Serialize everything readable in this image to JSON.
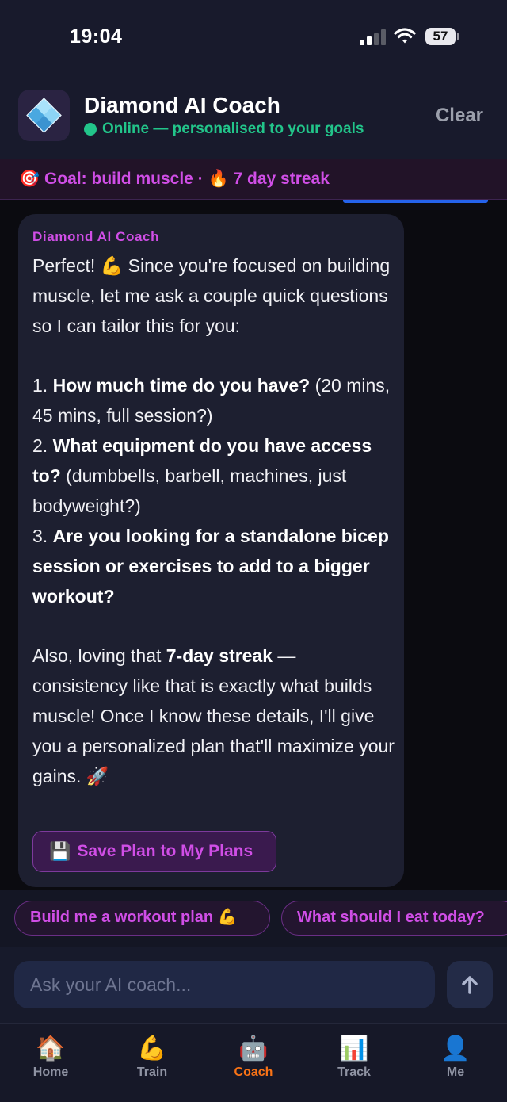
{
  "status_bar": {
    "time": "19:04",
    "battery": "57"
  },
  "header": {
    "title": "Diamond AI Coach",
    "status": "Online — personalised to your goals",
    "clear_label": "Clear"
  },
  "goal_bar": {
    "text": "🎯 Goal: build muscle · 🔥 7 day streak"
  },
  "message": {
    "sender": "Diamond AI Coach",
    "intro": "Perfect! 💪 Since you're focused on building muscle, let me ask a couple quick questions so I can tailor this for you:",
    "q1_num": "1. ",
    "q1_bold": "How much time do you have?",
    "q1_rest": " (20 mins, 45 mins, full session?)",
    "q2_num": "2. ",
    "q2_bold": "What equipment do you have access to?",
    "q2_rest": " (dumbbells, barbell, machines, just bodyweight?)",
    "q3_num": "3. ",
    "q3_bold": "Are you looking for a standalone bicep session or exercises to add to a bigger workout?",
    "outro_start": "Also, loving that ",
    "outro_bold": "7-day streak",
    "outro_rest": " — consistency like that is exactly what builds muscle! Once I know these details, I'll give you a personalized plan that'll maximize your gains. 🚀",
    "save_icon": "💾",
    "save_label": "Save Plan to My Plans"
  },
  "quick_replies": [
    "Build me a workout plan 💪",
    "What should I eat today?"
  ],
  "input": {
    "placeholder": "Ask your AI coach..."
  },
  "tabs": [
    {
      "icon": "🏠",
      "label": "Home"
    },
    {
      "icon": "💪",
      "label": "Train"
    },
    {
      "icon": "🤖",
      "label": "Coach"
    },
    {
      "icon": "📊",
      "label": "Track"
    },
    {
      "icon": "👤",
      "label": "Me"
    }
  ],
  "colors": {
    "accent": "#d04ee6",
    "online": "#22c58a",
    "active_tab": "#f97316"
  }
}
